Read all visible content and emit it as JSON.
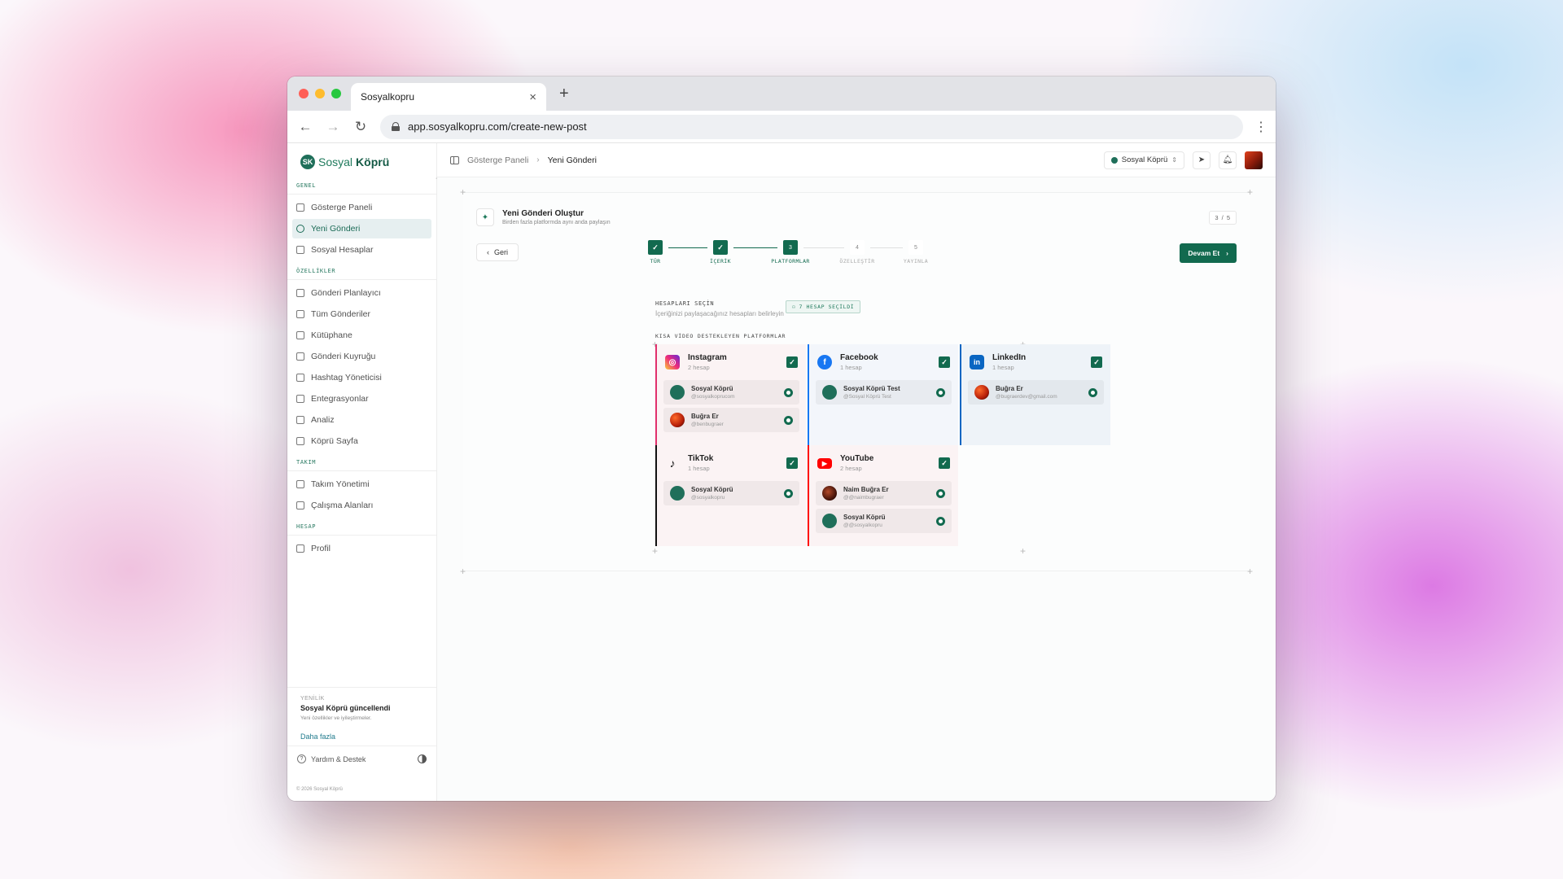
{
  "browser": {
    "tab_title": "Sosyalkopru",
    "tab_close": "×",
    "new_tab": "+",
    "url": "app.sosyalkopru.com/create-new-post",
    "back": "←",
    "forward": "→",
    "reload": "↻",
    "menu": "⋮"
  },
  "sidebar": {
    "logo_prefix": "Sosyal",
    "logo_bold": "Köprü",
    "sections": [
      {
        "label": "GENEL",
        "items": [
          {
            "label": "Gösterge Paneli",
            "active": false
          },
          {
            "label": "Yeni Gönderi",
            "active": true
          },
          {
            "label": "Sosyal Hesaplar",
            "active": false
          }
        ]
      },
      {
        "label": "ÖZELLİKLER",
        "items": [
          {
            "label": "Gönderi Planlayıcı"
          },
          {
            "label": "Tüm Gönderiler"
          },
          {
            "label": "Kütüphane"
          },
          {
            "label": "Gönderi Kuyruğu"
          },
          {
            "label": "Hashtag Yöneticisi"
          },
          {
            "label": "Entegrasyonlar"
          },
          {
            "label": "Analiz"
          },
          {
            "label": "Köprü Sayfa"
          }
        ]
      },
      {
        "label": "TAKIM",
        "items": [
          {
            "label": "Takım Yönetimi"
          },
          {
            "label": "Çalışma Alanları"
          }
        ]
      },
      {
        "label": "HESAP",
        "items": [
          {
            "label": "Profil"
          }
        ]
      }
    ],
    "news": {
      "tag": "YENİLİK",
      "title": "Sosyal Köprü güncellendi",
      "subtitle": "Yeni özellikler ve iyileştirmeler.",
      "link": "Daha fazla"
    },
    "help_label": "Yardım & Destek",
    "copyright": "© 2026 Sosyal Köprü"
  },
  "topbar": {
    "breadcrumb": [
      "Gösterge Paneli",
      "Yeni Gönderi"
    ],
    "workspace": "Sosyal Köprü"
  },
  "header": {
    "title": "Yeni Gönderi Oluştur",
    "subtitle": "Birden fazla platformda aynı anda paylaşın",
    "page_count": "3 / 5"
  },
  "nav": {
    "back_label": "Geri",
    "next_label": "Devam Et"
  },
  "steps": [
    {
      "label": "TÜR",
      "state": "done",
      "num": "1"
    },
    {
      "label": "İÇERİK",
      "state": "done",
      "num": "2"
    },
    {
      "label": "PLATFORMLAR",
      "state": "current",
      "num": "3"
    },
    {
      "label": "ÖZELLEŞTİR",
      "state": "todo",
      "num": "4"
    },
    {
      "label": "YAYINLA",
      "state": "todo",
      "num": "5"
    }
  ],
  "accounts": {
    "title": "HESAPLARI SEÇİN",
    "subtitle": "İçeriğinizi paylaşacağınız hesapları belirleyin",
    "selected_badge": "7 HESAP SEÇİLDİ",
    "short_video_label": "KISA VİDEO DESTEKLEYEN PLATFORMLAR"
  },
  "platforms": [
    {
      "name": "Instagram",
      "count": "2 hesap",
      "icon": "instagram-icon",
      "color": "#e1306c",
      "tint": "#fbf3f4",
      "accounts": [
        {
          "name": "Sosyal Köprü",
          "handle": "@sosyalkoprucom",
          "avatar": "green"
        },
        {
          "name": "Buğra Er",
          "handle": "@benbugraer",
          "avatar": "fire"
        }
      ]
    },
    {
      "name": "Facebook",
      "count": "1 hesap",
      "icon": "facebook-icon",
      "color": "#1877f2",
      "tint": "#f3f6fb",
      "accounts": [
        {
          "name": "Sosyal Köprü Test",
          "handle": "@Sosyal Köprü Test",
          "avatar": "green"
        }
      ]
    },
    {
      "name": "LinkedIn",
      "count": "1 hesap",
      "icon": "linkedin-icon",
      "color": "#0a66c2",
      "tint": "#eef3f8",
      "accounts": [
        {
          "name": "Buğra Er",
          "handle": "@bugraerdev@gmail.com",
          "avatar": "fire"
        }
      ]
    },
    {
      "name": "TikTok",
      "count": "1 hesap",
      "icon": "tiktok-icon",
      "color": "#111111",
      "tint": "#fbf3f4",
      "accounts": [
        {
          "name": "Sosyal Köprü",
          "handle": "@sosyalkopru",
          "avatar": "green"
        }
      ]
    },
    {
      "name": "YouTube",
      "count": "2 hesap",
      "icon": "youtube-icon",
      "color": "#ff0000",
      "tint": "#fbf3f4",
      "accounts": [
        {
          "name": "Naim Buğra Er",
          "handle": "@@naimbugraer",
          "avatar": "dark"
        },
        {
          "name": "Sosyal Köprü",
          "handle": "@@sosyalkopru",
          "avatar": "green"
        }
      ]
    }
  ]
}
